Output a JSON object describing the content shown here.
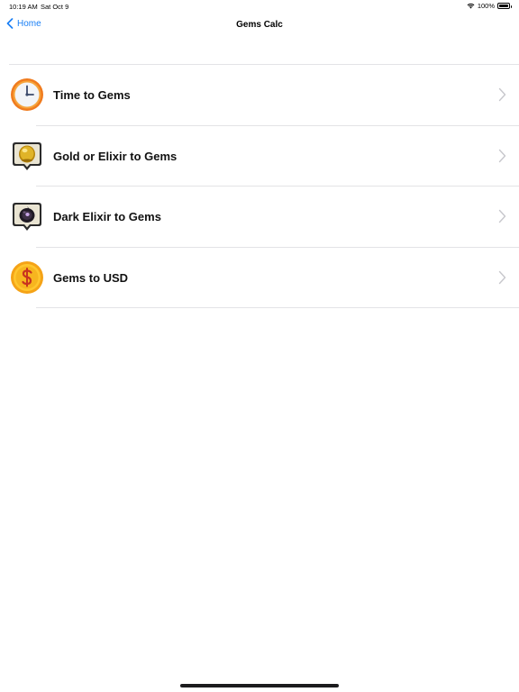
{
  "status_bar": {
    "time": "10:19 AM",
    "date": "Sat Oct 9",
    "battery": "100%"
  },
  "nav": {
    "back_label": "Home",
    "title": "Gems Calc"
  },
  "items": [
    {
      "label": "Time to Gems",
      "icon": "clock-icon"
    },
    {
      "label": "Gold or Elixir to Gems",
      "icon": "gold-elixir-icon"
    },
    {
      "label": "Dark Elixir to Gems",
      "icon": "dark-elixir-icon"
    },
    {
      "label": "Gems to USD",
      "icon": "dollar-coin-icon"
    }
  ],
  "colors": {
    "accent": "#1a7ff5",
    "separator": "#e3e3e6",
    "chevron": "#c7c7cc"
  }
}
